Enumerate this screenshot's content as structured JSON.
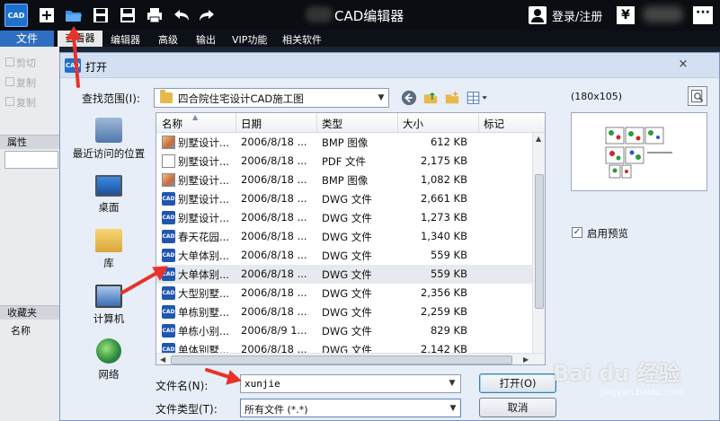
{
  "app": {
    "logo": "CAD",
    "title": "CAD编辑器",
    "login": "登录/注册",
    "yen": "¥",
    "more": "···"
  },
  "menu": {
    "file": "文件",
    "items": [
      "查看器",
      "编辑器",
      "高级",
      "输出",
      "VIP功能",
      "相关软件"
    ]
  },
  "left_panel": {
    "items": [
      "剪切",
      "复制",
      "复制"
    ],
    "properties": "属性",
    "favorites": "收藏夹",
    "name": "名称"
  },
  "dialog": {
    "logo": "CAD",
    "title": "打开",
    "close": "×",
    "look_in_label": "查找范围(I):",
    "look_in_value": "四合院住宅设计CAD施工图",
    "places": [
      "最近访问的位置",
      "桌面",
      "库",
      "计算机",
      "网络"
    ],
    "columns": [
      "名称",
      "日期",
      "类型",
      "大小",
      "标记"
    ],
    "files": [
      {
        "icon": "bmp",
        "name": "别墅设计...",
        "date": "2006/8/18 ...",
        "type": "BMP 图像",
        "size": "612 KB"
      },
      {
        "icon": "pdf",
        "name": "别墅设计...",
        "date": "2006/8/18 ...",
        "type": "PDF 文件",
        "size": "2,175 KB"
      },
      {
        "icon": "bmp",
        "name": "别墅设计...",
        "date": "2006/8/18 ...",
        "type": "BMP 图像",
        "size": "1,082 KB"
      },
      {
        "icon": "dwg",
        "name": "别墅设计...",
        "date": "2006/8/18 ...",
        "type": "DWG 文件",
        "size": "2,661 KB"
      },
      {
        "icon": "dwg",
        "name": "别墅设计...",
        "date": "2006/8/18 ...",
        "type": "DWG 文件",
        "size": "1,273 KB"
      },
      {
        "icon": "dwg",
        "name": "春天花园...",
        "date": "2006/8/18 ...",
        "type": "DWG 文件",
        "size": "1,340 KB"
      },
      {
        "icon": "dwg",
        "name": "大单体别...",
        "date": "2006/8/18 ...",
        "type": "DWG 文件",
        "size": "559 KB"
      },
      {
        "icon": "dwg",
        "name": "大单体别...",
        "date": "2006/8/18 ...",
        "type": "DWG 文件",
        "size": "559 KB"
      },
      {
        "icon": "dwg",
        "name": "大型别墅...",
        "date": "2006/8/18 ...",
        "type": "DWG 文件",
        "size": "2,356 KB"
      },
      {
        "icon": "dwg",
        "name": "单栋别墅...",
        "date": "2006/8/18 ...",
        "type": "DWG 文件",
        "size": "2,259 KB"
      },
      {
        "icon": "dwg",
        "name": "单栋小别...",
        "date": "2006/8/9 1...",
        "type": "DWG 文件",
        "size": "829 KB"
      },
      {
        "icon": "dwg",
        "name": "单体别墅...",
        "date": "2006/8/18 ...",
        "type": "DWG 文件",
        "size": "2,142 KB"
      }
    ],
    "selected_row": 7,
    "preview_size": "(180x105)",
    "preview_checkbox": "启用预览",
    "preview_checked": true,
    "filename_label": "文件名(N):",
    "filename_value": "xunjie",
    "filetype_label": "文件类型(T):",
    "filetype_value": "所有文件 (*.*)",
    "open_button": "打开(O)",
    "cancel_button": "取消"
  },
  "watermark": {
    "main": "Bai du 经验",
    "sub": "jingyan.baidu.com"
  },
  "colors": {
    "accent_blue": "#2f6fc1",
    "annotation_red": "#e8322c"
  }
}
